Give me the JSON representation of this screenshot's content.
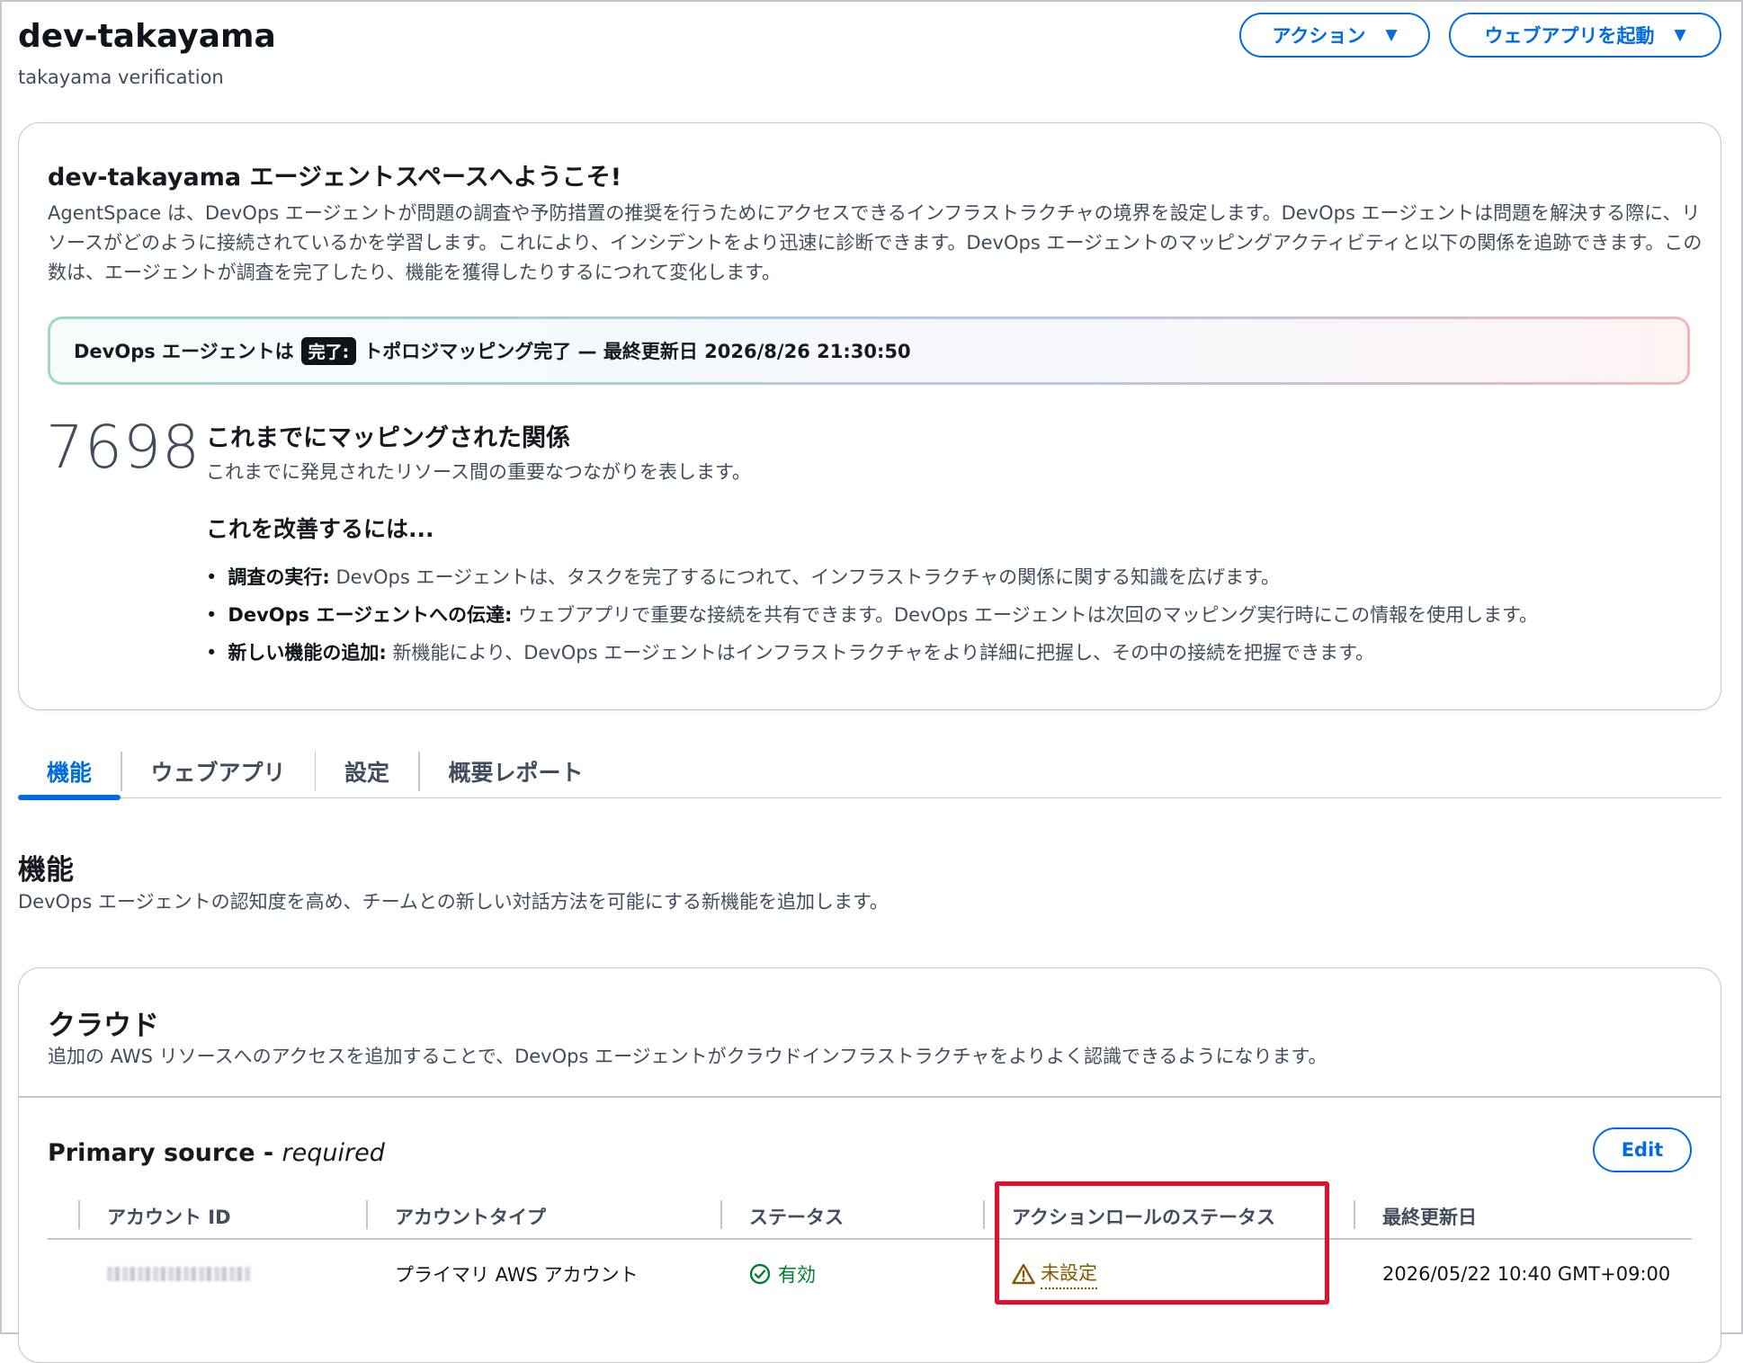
{
  "header": {
    "title": "dev-takayama",
    "subtitle": "takayama verification",
    "actions_label": "アクション",
    "launch_label": "ウェブアプリを起動"
  },
  "welcome": {
    "title": "dev-takayama エージェントスペースへようこそ!",
    "description": "AgentSpace は、DevOps エージェントが問題の調査や予防措置の推奨を行うためにアクセスできるインフラストラクチャの境界を設定します。DevOps エージェントは問題を解決する際に、リソースがどのように接続されているかを学習します。これにより、インシデントをより迅速に診断できます。DevOps エージェントのマッピングアクティビティと以下の関係を追跡できます。この数は、エージェントが調査を完了したり、機能を獲得したりするにつれて変化します。",
    "status_prefix": "DevOps エージェントは",
    "status_badge": "完了:",
    "status_suffix": "トポロジマッピング完了 — 最終更新日 2026/8/26 21:30:50",
    "count": "7698",
    "count_title": "これまでにマッピングされた関係",
    "count_desc": "これまでに発見されたリソース間の重要なつながりを表します。",
    "improve_title": "これを改善するには...",
    "bullets": [
      {
        "bold": "調査の実行:",
        "text": " DevOps エージェントは、タスクを完了するにつれて、インフラストラクチャの関係に関する知識を広げます。"
      },
      {
        "bold": "DevOps エージェントへの伝達:",
        "text": " ウェブアプリで重要な接続を共有できます。DevOps エージェントは次回のマッピング実行時にこの情報を使用します。"
      },
      {
        "bold": "新しい機能の追加:",
        "text": " 新機能により、DevOps エージェントはインフラストラクチャをより詳細に把握し、その中の接続を把握できます。"
      }
    ]
  },
  "tabs": [
    "機能",
    "ウェブアプリ",
    "設定",
    "概要レポート"
  ],
  "section": {
    "title": "機能",
    "description": "DevOps エージェントの認知度を高め、チームとの新しい対話方法を可能にする新機能を追加します。"
  },
  "cloud": {
    "title": "クラウド",
    "description": "追加の AWS リソースへのアクセスを追加することで、DevOps エージェントがクラウドインフラストラクチャをよりよく認識できるようになります。",
    "primary_title": "Primary source - ",
    "primary_required": "required",
    "edit_label": "Edit",
    "columns": [
      "アカウント ID",
      "アカウントタイプ",
      "ステータス",
      "アクションロールのステータス",
      "最終更新日"
    ],
    "row": {
      "account_type": "プライマリ AWS アカウント",
      "status": "有効",
      "action_role_status": "未設定",
      "updated": "2026/05/22 10:40 GMT+09:00"
    }
  },
  "colors": {
    "accent": "#006ce0",
    "success": "#00802f",
    "warning": "#855900",
    "highlight": "#e0112e"
  }
}
